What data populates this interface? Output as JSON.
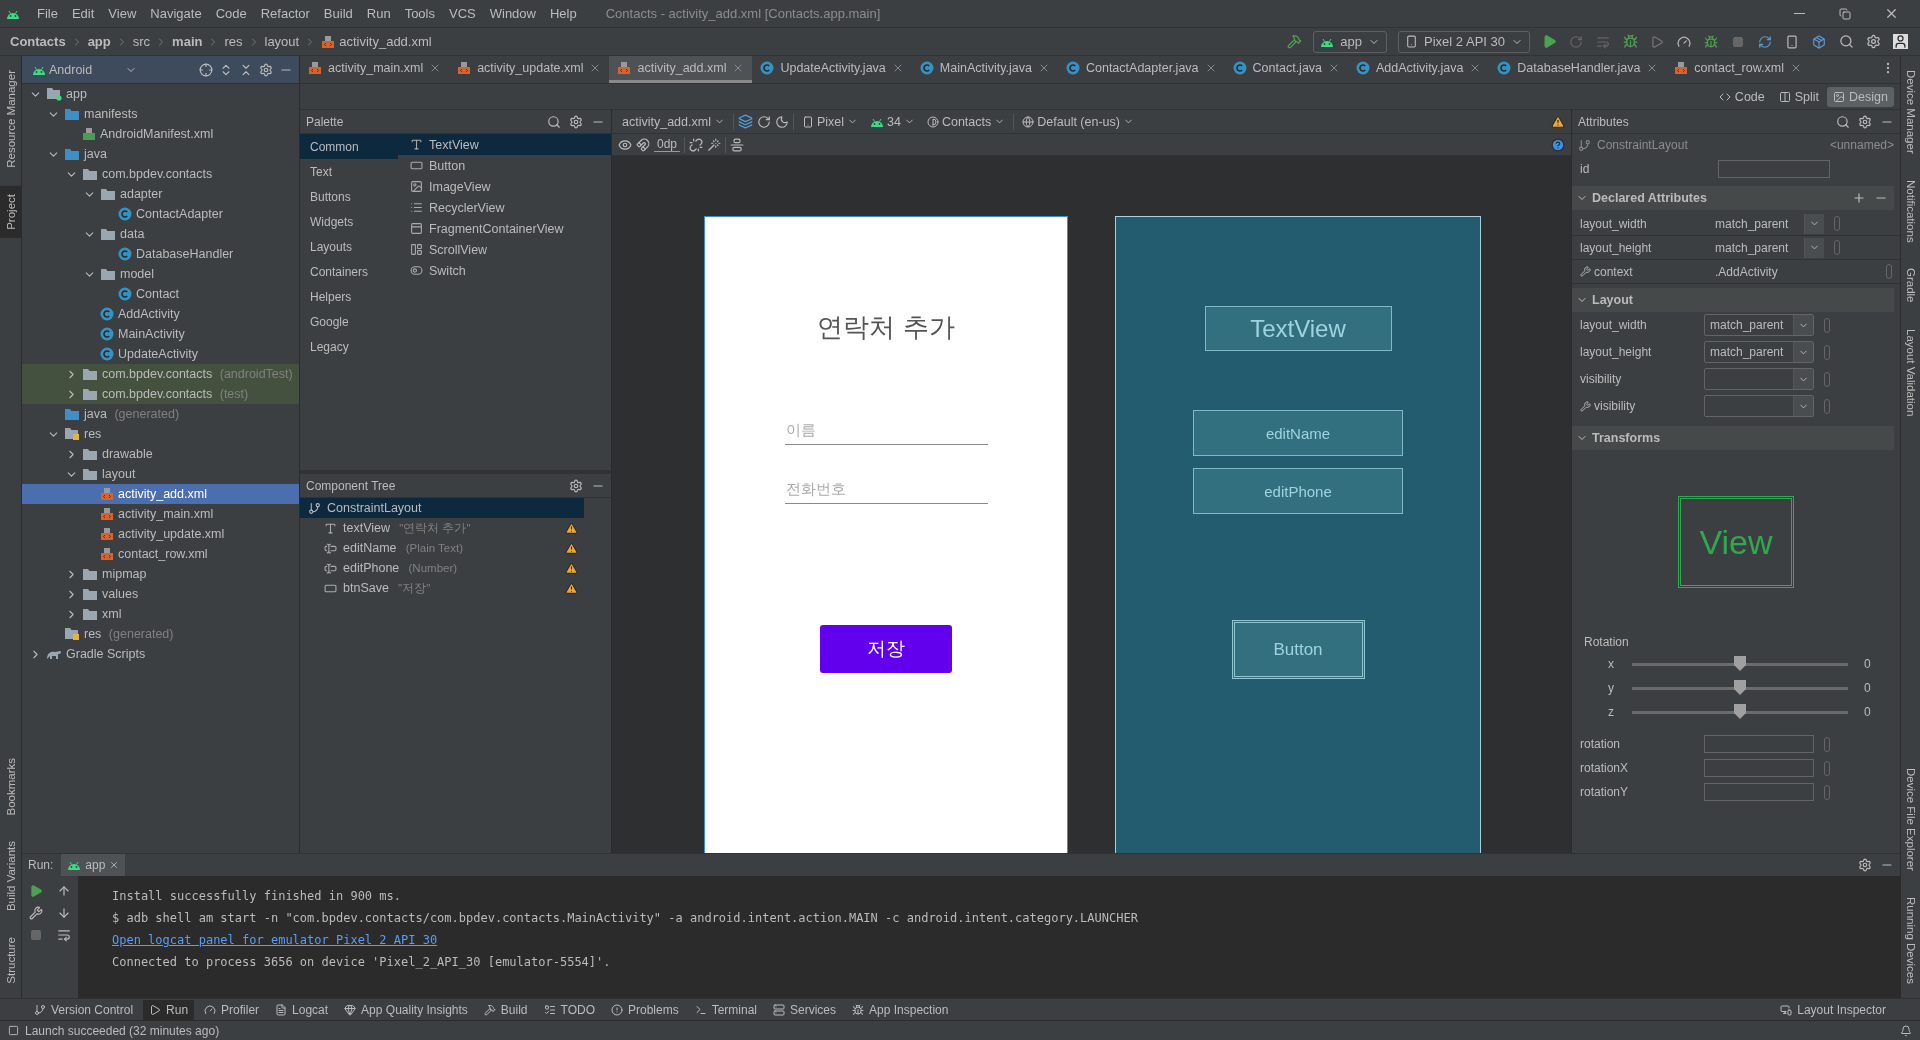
{
  "menu_bar": {
    "items": [
      "File",
      "Edit",
      "View",
      "Navigate",
      "Code",
      "Refactor",
      "Build",
      "Run",
      "Tools",
      "VCS",
      "Window",
      "Help"
    ],
    "title": "Contacts - activity_add.xml [Contacts.app.main]"
  },
  "breadcrumb": [
    {
      "label": "Contacts",
      "bold": true
    },
    {
      "label": "app",
      "bold": true
    },
    {
      "label": "src",
      "bold": false
    },
    {
      "label": "main",
      "bold": true
    },
    {
      "label": "res",
      "bold": false
    },
    {
      "label": "layout",
      "bold": false
    },
    {
      "label": "activity_add.xml",
      "bold": false,
      "kind": "xml"
    }
  ],
  "run_toolbar": {
    "configuration": "app",
    "device": "Pixel 2 API 30"
  },
  "left_stripe": {
    "top": [
      {
        "label": "Resource Manager",
        "selected": false
      },
      {
        "label": "Project",
        "selected": true
      }
    ],
    "bottom": [
      {
        "label": "Bookmarks",
        "selected": false
      },
      {
        "label": "Build Variants",
        "selected": false
      },
      {
        "label": "Structure",
        "selected": false
      }
    ]
  },
  "right_stripe": {
    "top": [
      {
        "label": "Device Manager"
      },
      {
        "label": "Notifications"
      },
      {
        "label": "Gradle"
      },
      {
        "label": "Layout Validation"
      }
    ],
    "bottom": [
      {
        "label": "Device File Explorer"
      },
      {
        "label": "Running Devices"
      }
    ]
  },
  "project": {
    "view": "Android",
    "tree": [
      {
        "label": "app",
        "kind": "module",
        "expanded": true,
        "selected": false,
        "children": [
          {
            "label": "manifests",
            "kind": "source",
            "expanded": true,
            "selected": false,
            "children": [
              {
                "label": "AndroidManifest.xml",
                "kind": "manifest",
                "selected": false
              }
            ]
          },
          {
            "label": "java",
            "kind": "source",
            "expanded": true,
            "selected": false,
            "children": [
              {
                "label": "com.bpdev.contacts",
                "kind": "package",
                "expanded": true,
                "selected": false,
                "children": [
                  {
                    "label": "adapter",
                    "kind": "package",
                    "expanded": true,
                    "selected": false,
                    "children": [
                      {
                        "label": "ContactAdapter",
                        "kind": "class",
                        "selected": false
                      }
                    ]
                  },
                  {
                    "label": "data",
                    "kind": "package",
                    "expanded": true,
                    "selected": false,
                    "children": [
                      {
                        "label": "DatabaseHandler",
                        "kind": "class",
                        "selected": false
                      }
                    ]
                  },
                  {
                    "label": "model",
                    "kind": "package",
                    "expanded": true,
                    "selected": false,
                    "children": [
                      {
                        "label": "Contact",
                        "kind": "class",
                        "selected": false
                      }
                    ]
                  },
                  {
                    "label": "AddActivity",
                    "kind": "class",
                    "selected": false
                  },
                  {
                    "label": "MainActivity",
                    "kind": "class",
                    "selected": false
                  },
                  {
                    "label": "UpdateActivity",
                    "kind": "class",
                    "selected": false
                  }
                ]
              },
              {
                "label": "com.bpdev.contacts",
                "suffix": "(androidTest)",
                "kind": "test",
                "expanded": false,
                "selected": false
              },
              {
                "label": "com.bpdev.contacts",
                "suffix": "(test)",
                "kind": "test",
                "expanded": false,
                "selected": false
              }
            ]
          },
          {
            "label": "java",
            "suffix": "(generated)",
            "kind": "generated",
            "selected": false
          },
          {
            "label": "res",
            "kind": "res",
            "expanded": true,
            "selected": false,
            "children": [
              {
                "label": "drawable",
                "kind": "package",
                "expanded": false,
                "selected": false
              },
              {
                "label": "layout",
                "kind": "package",
                "expanded": true,
                "selected": false,
                "children": [
                  {
                    "label": "activity_add.xml",
                    "kind": "xml",
                    "selected": true
                  },
                  {
                    "label": "activity_main.xml",
                    "kind": "xml",
                    "selected": false
                  },
                  {
                    "label": "activity_update.xml",
                    "kind": "xml",
                    "selected": false
                  },
                  {
                    "label": "contact_row.xml",
                    "kind": "xml",
                    "selected": false
                  }
                ]
              },
              {
                "label": "mipmap",
                "kind": "package",
                "expanded": false,
                "selected": false
              },
              {
                "label": "values",
                "kind": "package",
                "expanded": false,
                "selected": false
              },
              {
                "label": "xml",
                "kind": "package",
                "expanded": false,
                "selected": false
              }
            ]
          },
          {
            "label": "res",
            "suffix": "(generated)",
            "kind": "res",
            "selected": false
          }
        ]
      },
      {
        "label": "Gradle Scripts",
        "kind": "gradle",
        "expanded": false,
        "selected": false
      }
    ]
  },
  "editor_tabs": [
    {
      "label": "activity_main.xml",
      "kind": "xml",
      "selected": false
    },
    {
      "label": "activity_update.xml",
      "kind": "xml",
      "selected": false
    },
    {
      "label": "activity_add.xml",
      "kind": "xml",
      "selected": true
    },
    {
      "label": "UpdateActivity.java",
      "kind": "class",
      "selected": false
    },
    {
      "label": "MainActivity.java",
      "kind": "class",
      "selected": false
    },
    {
      "label": "ContactAdapter.java",
      "kind": "class",
      "selected": false
    },
    {
      "label": "Contact.java",
      "kind": "class",
      "selected": false
    },
    {
      "label": "AddActivity.java",
      "kind": "class",
      "selected": false
    },
    {
      "label": "DatabaseHandler.java",
      "kind": "class",
      "selected": false
    },
    {
      "label": "contact_row.xml",
      "kind": "xml",
      "selected": false
    }
  ],
  "view_modes": [
    {
      "label": "Code",
      "kind": "code",
      "selected": false
    },
    {
      "label": "Split",
      "kind": "split",
      "selected": false
    },
    {
      "label": "Design",
      "kind": "design",
      "selected": true
    }
  ],
  "palette": {
    "title": "Palette",
    "categories": [
      {
        "label": "Common",
        "selected": true
      },
      {
        "label": "Text",
        "selected": false
      },
      {
        "label": "Buttons",
        "selected": false
      },
      {
        "label": "Widgets",
        "selected": false
      },
      {
        "label": "Layouts",
        "selected": false
      },
      {
        "label": "Containers",
        "selected": false
      },
      {
        "label": "Helpers",
        "selected": false
      },
      {
        "label": "Google",
        "selected": false
      },
      {
        "label": "Legacy",
        "selected": false
      }
    ],
    "items": [
      {
        "label": "TextView",
        "kind": "text",
        "selected": true
      },
      {
        "label": "Button",
        "kind": "button",
        "selected": false
      },
      {
        "label": "ImageView",
        "kind": "image",
        "selected": false
      },
      {
        "label": "RecyclerView",
        "kind": "list",
        "selected": false
      },
      {
        "label": "FragmentContainerView",
        "kind": "fragment",
        "selected": false
      },
      {
        "label": "ScrollView",
        "kind": "scroll",
        "selected": false
      },
      {
        "label": "Switch",
        "kind": "switch",
        "selected": false
      }
    ]
  },
  "component_tree": {
    "title": "Component Tree",
    "root": {
      "label": "ConstraintLayout",
      "selected": true
    },
    "children": [
      {
        "label": "textView",
        "detail": "\"연락처 추가\"",
        "kind": "text",
        "warning": true
      },
      {
        "label": "editName",
        "detail": "(Plain Text)",
        "kind": "field",
        "warning": true
      },
      {
        "label": "editPhone",
        "detail": "(Number)",
        "kind": "field",
        "warning": true
      },
      {
        "label": "btnSave",
        "detail": "\"저장\"",
        "kind": "button",
        "warning": true
      }
    ]
  },
  "design_toolbar": {
    "file": "activity_add.xml",
    "device": "Pixel",
    "api": "34",
    "theme": "Contacts",
    "locale": "Default (en-us)",
    "margin": "0dp"
  },
  "design": {
    "title": "연락처 추가",
    "fields": [
      {
        "placeholder": "이름"
      },
      {
        "placeholder": "전화번호"
      }
    ],
    "button": "저장"
  },
  "blueprint": {
    "items": [
      {
        "label": "TextView",
        "kind": "text"
      },
      {
        "label": "editName",
        "kind": "field"
      },
      {
        "label": "editPhone",
        "kind": "field"
      },
      {
        "label": "Button",
        "kind": "button"
      }
    ]
  },
  "attributes": {
    "title": "Attributes",
    "component": "ConstraintLayout",
    "component_name": "<unnamed>",
    "id_label": "id",
    "sections": [
      {
        "title": "Declared Attributes",
        "kind": "declared",
        "expanded": true,
        "rows": [
          {
            "label": "layout_width",
            "value": "match_parent",
            "kind": "dropdown",
            "tool": false
          },
          {
            "label": "layout_height",
            "value": "match_parent",
            "kind": "dropdown",
            "tool": false
          },
          {
            "label": "context",
            "value": ".AddActivity",
            "kind": "text",
            "tool": true
          }
        ]
      },
      {
        "title": "Layout",
        "kind": "layout",
        "expanded": true,
        "rows": [
          {
            "label": "layout_width",
            "value": "match_parent",
            "kind": "combo",
            "tool": false
          },
          {
            "label": "layout_height",
            "value": "match_parent",
            "kind": "combo",
            "tool": false
          },
          {
            "label": "visibility",
            "kind": "combo",
            "tool": false
          },
          {
            "label": "visibility",
            "kind": "combo",
            "tool": true
          }
        ]
      },
      {
        "title": "Transforms",
        "kind": "transforms",
        "expanded": true
      }
    ],
    "transforms": {
      "preview": "View",
      "rotation_title": "Rotation",
      "sliders": [
        {
          "axis": "x",
          "level": 0.5,
          "reading": "0"
        },
        {
          "axis": "y",
          "level": 0.5,
          "reading": "0"
        },
        {
          "axis": "z",
          "level": 0.5,
          "reading": "0"
        }
      ],
      "rows": [
        {
          "label": "rotation"
        },
        {
          "label": "rotationX"
        },
        {
          "label": "rotationY"
        }
      ]
    }
  },
  "run_panel": {
    "title": "Run:",
    "tab": "app",
    "lines": [
      {
        "text": "Install successfully finished in 900 ms.",
        "kind": "plain"
      },
      {
        "text": "$ adb shell am start -n \"com.bpdev.contacts/com.bpdev.contacts.MainActivity\" -a android.intent.action.MAIN -c android.intent.category.LAUNCHER",
        "kind": "plain"
      },
      {
        "text": "Open logcat panel for emulator Pixel 2 API 30",
        "kind": "link"
      },
      {
        "text": "Connected to process 3656 on device 'Pixel_2_API_30 [emulator-5554]'.",
        "kind": "plain"
      }
    ]
  },
  "tool_windows": {
    "left": [
      {
        "label": "Version Control",
        "kind": "vcs",
        "selected": false
      },
      {
        "label": "Run",
        "kind": "run",
        "selected": true
      },
      {
        "label": "Profiler",
        "kind": "profiler",
        "selected": false
      },
      {
        "label": "Logcat",
        "kind": "logcat",
        "selected": false
      },
      {
        "label": "App Quality Insights",
        "kind": "insights",
        "selected": false
      },
      {
        "label": "Build",
        "kind": "build",
        "selected": false
      },
      {
        "label": "TODO",
        "kind": "todo",
        "selected": false
      },
      {
        "label": "Problems",
        "kind": "problems",
        "selected": false
      },
      {
        "label": "Terminal",
        "kind": "terminal",
        "selected": false
      },
      {
        "label": "Services",
        "kind": "services",
        "selected": false
      },
      {
        "label": "App Inspection",
        "kind": "inspection",
        "selected": false
      }
    ],
    "right": [
      {
        "label": "Layout Inspector",
        "kind": "inspector",
        "selected": false
      }
    ]
  },
  "status_bar": {
    "message": "Launch succeeded (32 minutes ago)"
  }
}
